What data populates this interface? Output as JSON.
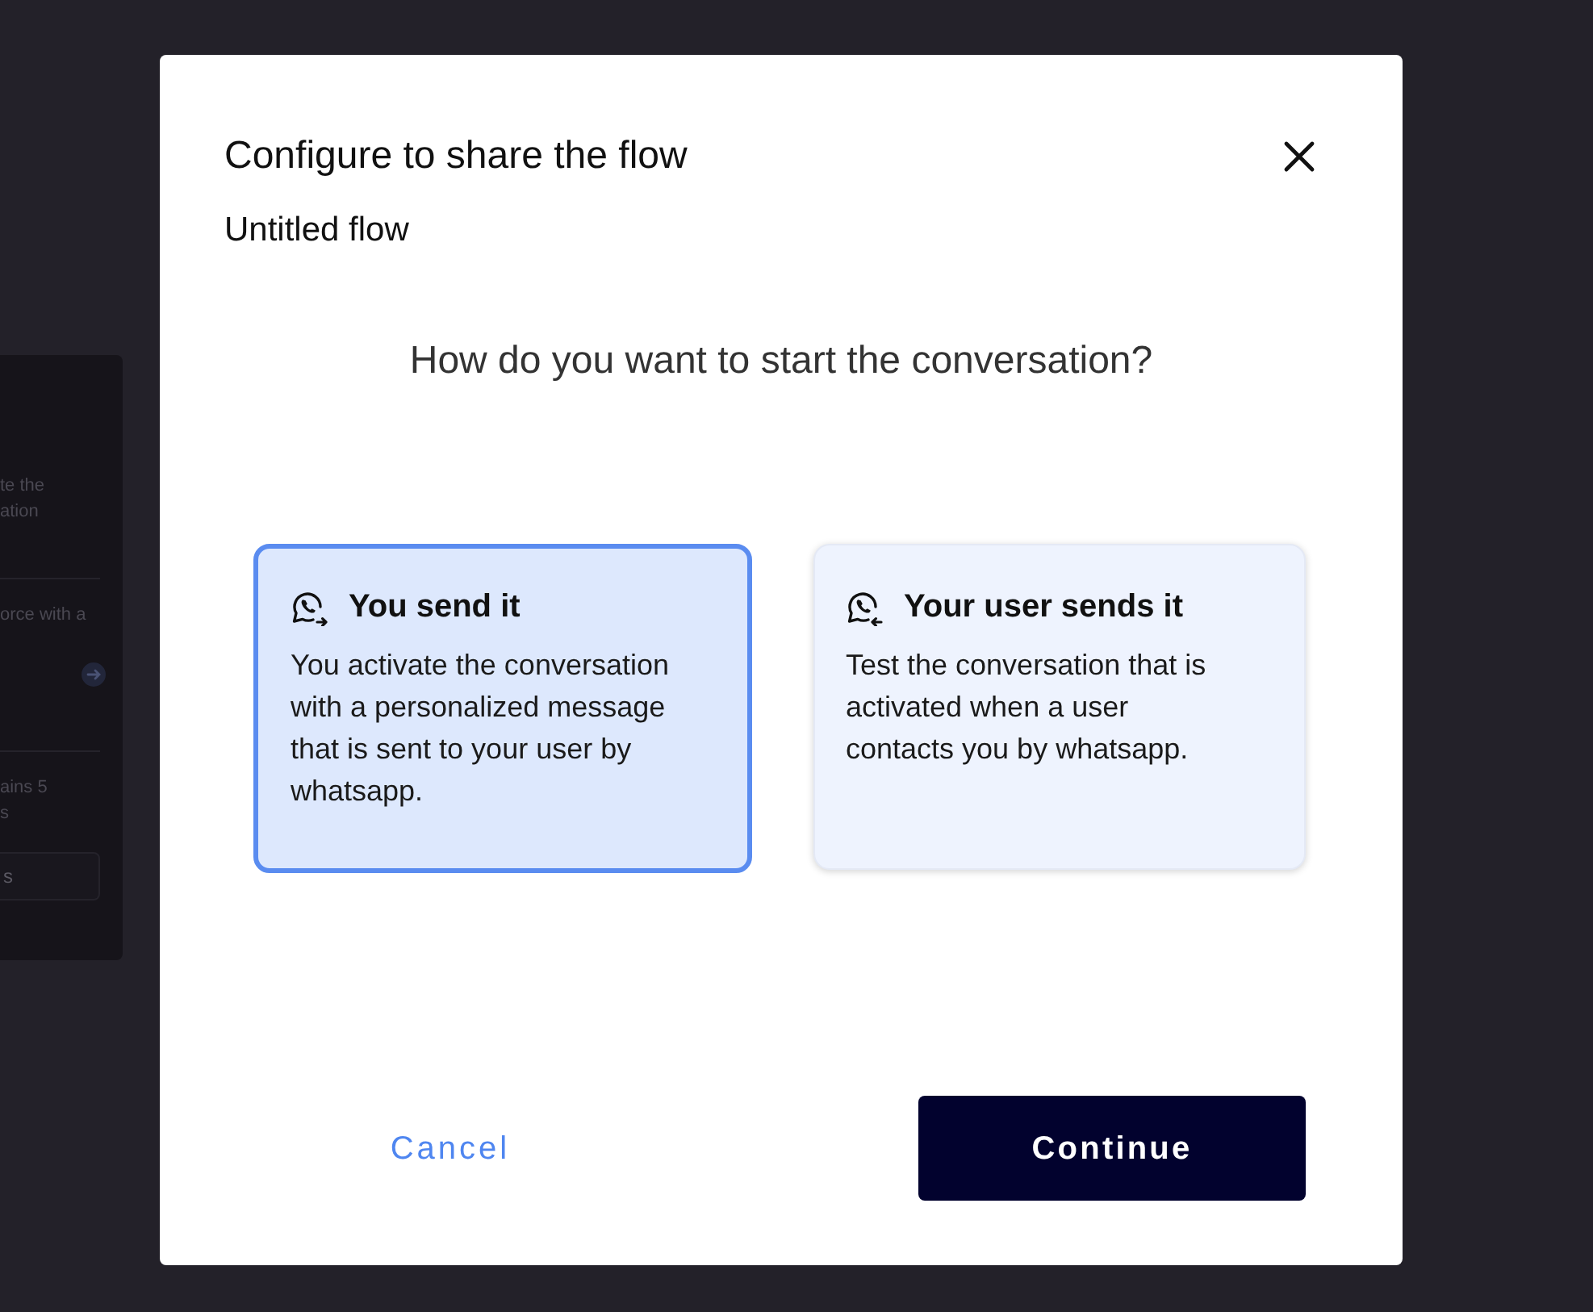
{
  "background_panel": {
    "sections": [
      {
        "kind": "text",
        "lines": [
          "te the",
          "ation"
        ]
      },
      {
        "kind": "arrow",
        "lines": [
          "orce with a"
        ]
      },
      {
        "kind": "button",
        "lines": [
          "ains 5",
          "s"
        ],
        "button": "s"
      }
    ]
  },
  "modal": {
    "title": "Configure to share the flow",
    "subtitle": "Untitled flow",
    "question": "How do you want to start the conversation?",
    "options": [
      {
        "kind": "send",
        "title": "You send it",
        "description": "You activate the conversation with a personalized message that is sent to your user by whatsapp.",
        "selected": true
      },
      {
        "kind": "receive",
        "title": "Your user sends it",
        "description": "Test the conversation that is activated when a user contacts you by whatsapp.",
        "selected": false
      }
    ],
    "buttons": [
      {
        "kind": "secondary",
        "label": "Cancel"
      },
      {
        "kind": "primary",
        "label": "Continue"
      }
    ]
  }
}
